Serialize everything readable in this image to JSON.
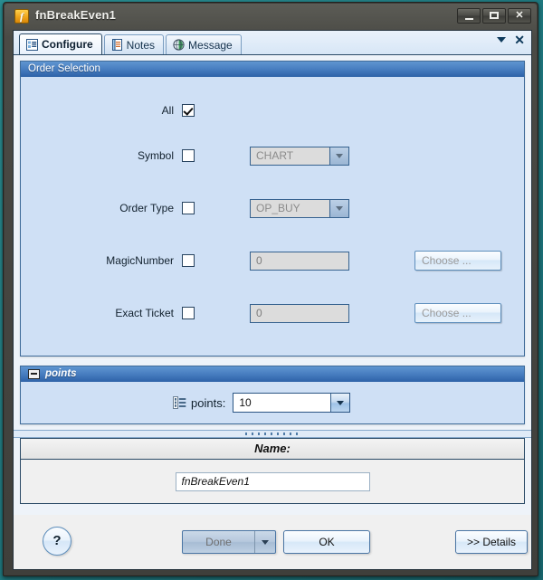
{
  "window": {
    "title": "fnBreakEven1",
    "icon": "function-f-icon",
    "controls": {
      "minimize": "–",
      "maximize": "□",
      "close": "✕"
    }
  },
  "tabstrip": {
    "tabs": [
      {
        "label": "Configure",
        "icon": "configure-list-icon",
        "active": true
      },
      {
        "label": "Notes",
        "icon": "notes-icon",
        "active": false
      },
      {
        "label": "Message",
        "icon": "message-globe-icon",
        "active": false
      }
    ],
    "dropdown_icon": "chevron-down-icon",
    "close_icon": "close-icon"
  },
  "order_selection": {
    "header": "Order Selection",
    "rows": [
      {
        "label": "All",
        "checked": true,
        "control": "none"
      },
      {
        "label": "Symbol",
        "checked": false,
        "control": "combo",
        "value": "CHART",
        "enabled": false
      },
      {
        "label": "Order Type",
        "checked": false,
        "control": "combo",
        "value": "OP_BUY",
        "enabled": false
      },
      {
        "label": "MagicNumber",
        "checked": false,
        "control": "text",
        "value": "0",
        "enabled": false,
        "button": "Choose ..."
      },
      {
        "label": "Exact Ticket",
        "checked": false,
        "control": "text",
        "value": "0",
        "enabled": false,
        "button": "Choose ..."
      }
    ]
  },
  "points_group": {
    "header": "points",
    "collapse_icon": "collapse-box-icon",
    "field_icon": "parameter-list-icon",
    "label": "points:",
    "value": "10",
    "options": [
      "10"
    ]
  },
  "name_panel": {
    "header": "Name:",
    "value": "fnBreakEven1"
  },
  "footer": {
    "help": "?",
    "done": "Done",
    "done_enabled": false,
    "ok": "OK",
    "details": ">> Details"
  },
  "colors": {
    "accent_blue": "#2d62a8",
    "group_bg": "#cfe0f5",
    "panel_bg": "#f0f0f0",
    "title_icon": "#f0a81e",
    "desktop": "#1f7f86"
  }
}
